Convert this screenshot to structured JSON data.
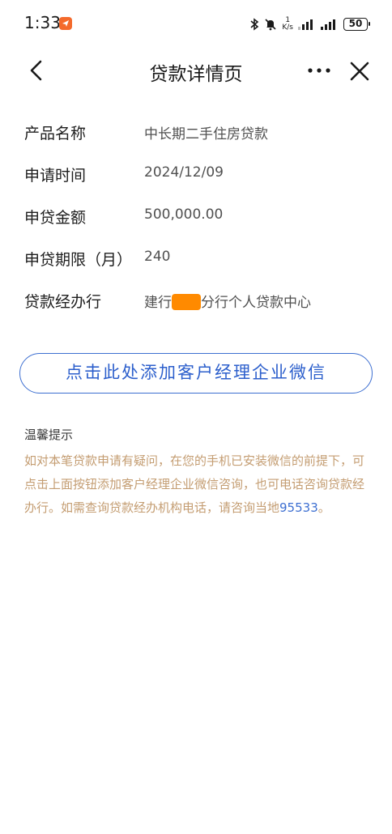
{
  "status_bar": {
    "time": "1:33",
    "net_speed_value": "1",
    "net_speed_unit": "K/s",
    "battery": "50",
    "icons": [
      "app-notification-icon",
      "bluetooth-icon",
      "mute-icon",
      "signal-icon",
      "signal-icon",
      "battery-icon"
    ]
  },
  "nav": {
    "title": "贷款详情页",
    "icons": [
      "back-arrow-icon",
      "more-icon",
      "close-icon"
    ]
  },
  "details": [
    {
      "label": "产品名称",
      "value": "中长期二手住房贷款"
    },
    {
      "label": "申请时间",
      "value": "2024/12/09"
    },
    {
      "label": "申贷金额",
      "value": "500,000.00"
    },
    {
      "label": "申贷期限（月）",
      "value": "240"
    },
    {
      "label": "贷款经办行",
      "value_prefix": "建行",
      "value_suffix": "分行个人贷款中心"
    }
  ],
  "button": {
    "label": "点击此处添加客户经理企业微信"
  },
  "tips": {
    "title": "温馨提示",
    "body": "如对本笔贷款申请有疑问，在您的手机已安装微信的前提下，可点击上面按钮添加客户经理企业微信咨询，也可电话咨询贷款经办行。如需查询贷款经办机构电话，请咨询当地",
    "phone": "95533",
    "end": "。"
  },
  "colors": {
    "accent_blue": "#3d6fd1",
    "tips_text": "#c49d72",
    "redaction": "#ff8a00"
  }
}
